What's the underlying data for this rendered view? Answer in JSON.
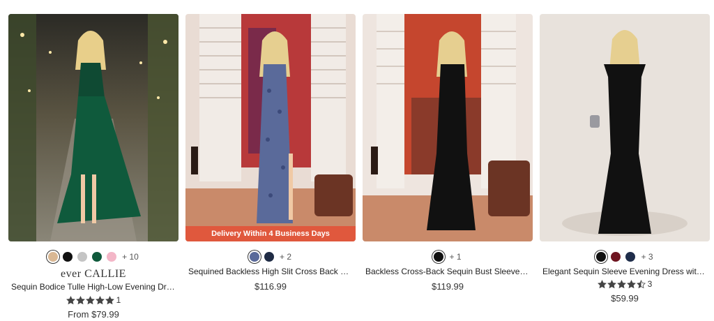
{
  "products": [
    {
      "image_alt": "",
      "swatches": [
        "#d9b894",
        "#111111",
        "#c4c4c4",
        "#0f5a3c",
        "#f3b6c7"
      ],
      "more_colors": "+ 10",
      "brand": "ever CALLIE",
      "title": "Sequin Bodice Tulle High-Low Evening Dress wit...",
      "rating": 5,
      "rating_count": "1",
      "price": "From $79.99"
    },
    {
      "swatches": [
        "#5a6a9a",
        "#1f2b44"
      ],
      "more_colors": "+ 2",
      "banner": "Delivery Within 4 Business Days",
      "title": "Sequined Backless High Slit Cross Back Straps...",
      "price": "$116.99"
    },
    {
      "swatches": [
        "#111111"
      ],
      "more_colors": "+ 1",
      "title": "Backless Cross-Back Sequin Bust Sleeveless...",
      "price": "$119.99"
    },
    {
      "swatches": [
        "#111111",
        "#6e1520",
        "#1f2d4a"
      ],
      "more_colors": "+ 3",
      "title": "Elegant Sequin Sleeve Evening Dress with...",
      "rating": 4.5,
      "rating_count": "3",
      "price": "$59.99"
    }
  ]
}
